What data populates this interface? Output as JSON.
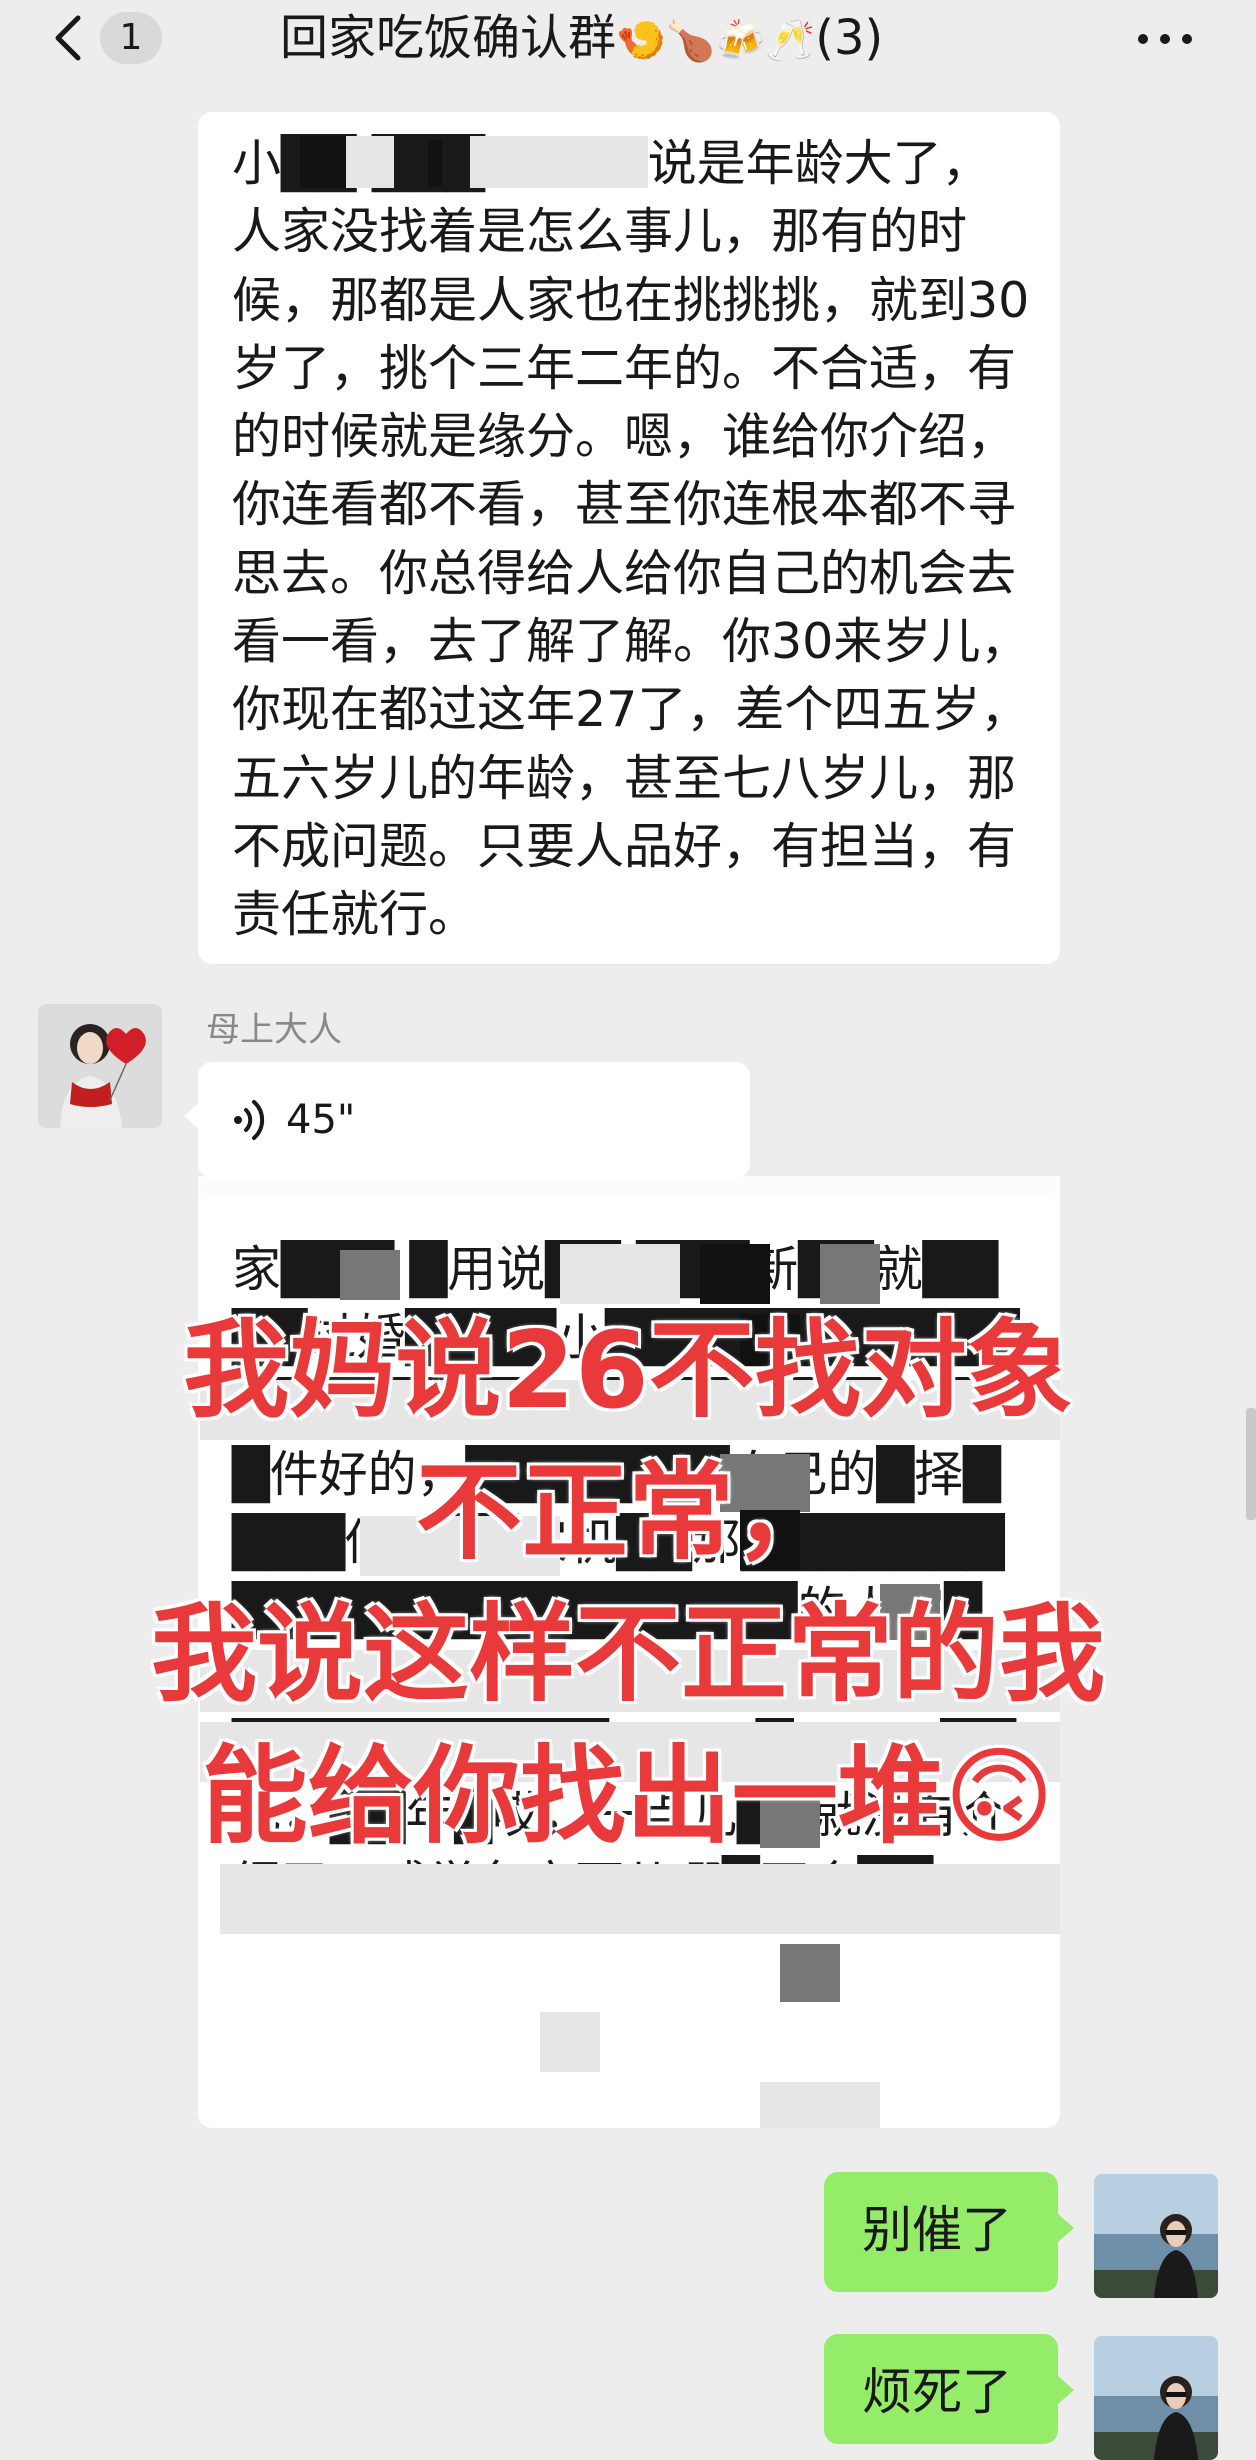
{
  "header": {
    "unread_count": "1",
    "title": "回家吃饭确认群",
    "title_emojis": "🍤🍗🍻🥂",
    "member_count": "(3)"
  },
  "messages": {
    "msg1_text": "小██  ███  你别看说是年龄大了，人家没找着是怎么事儿，那有的时候，那都是人家也在挑挑挑，就到30岁了，挑个三年二年的。不合适，有的时候就是缘分。嗯，谁给你介绍，你连看都不看，甚至你连根本都不寻思去。你总得给人给你自己的机会去看一看，去了解了解。你30来岁儿，你现在都过这年27了，差个四五岁，五六岁儿的年龄，甚至七八岁儿，那不成问题。只要人品好，有担当，有责任就行。",
    "sender_name": "母上大人",
    "voice_duration": "45\"",
    "msg2_text": "家███ █用说██ ███新██就████过婚████小███████████████████在█年██慢███要██件好的，███████自己的█择████你总██家机██那██████████████████████的人家█绍███有████他████████████████████慢慢儿█过了这██儿，██年█哎，一点儿██就没有介绍了，感觉各方面儿哪█不合██"
  },
  "overlay_caption": {
    "line1": "我妈说26不找对象",
    "line2": "不正常，",
    "line3": "我说这样不正常的我",
    "line4": "能给你找出一堆",
    "emoji": "🙃"
  },
  "replies": {
    "reply1": "别催了",
    "reply2": "烦死了"
  },
  "colors": {
    "background": "#ededed",
    "bubble_white": "#ffffff",
    "bubble_green": "#95ec69",
    "overlay_red": "#e83a3a",
    "sender_gray": "#888888"
  },
  "icons": {
    "back": "chevron-left-icon",
    "more": "more-dots-icon",
    "voice": "voice-wave-icon"
  }
}
